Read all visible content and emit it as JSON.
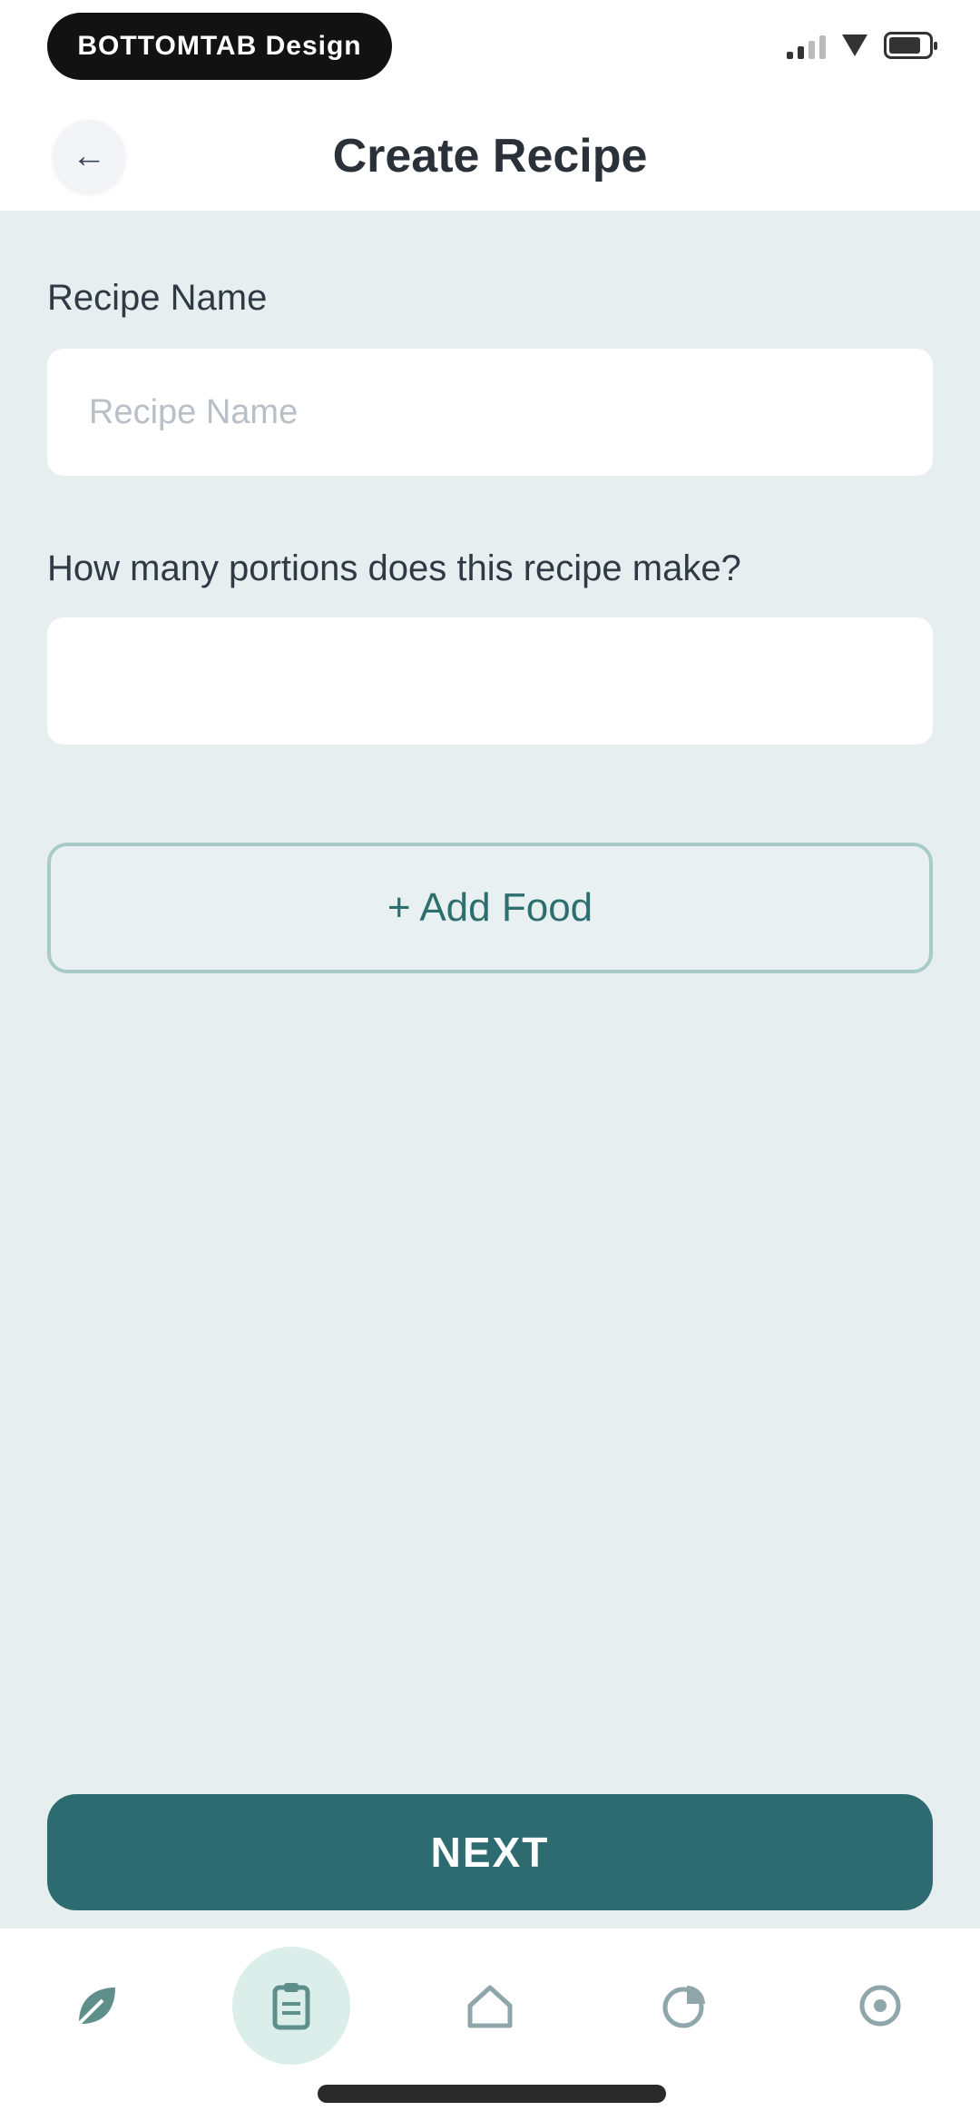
{
  "status_bar": {
    "pill_text": "BOTTOMTAB Design"
  },
  "header": {
    "title": "Create Recipe",
    "back_icon": "arrow-left-icon"
  },
  "form": {
    "recipe_name": {
      "label": "Recipe Name",
      "placeholder": "Recipe Name",
      "value": ""
    },
    "portions": {
      "label": "How many portions does this recipe make?",
      "placeholder": "",
      "value": ""
    },
    "add_food_label": "+ Add Food"
  },
  "actions": {
    "next_label": "NEXT"
  },
  "bottom_nav": {
    "items": [
      {
        "icon": "leaf-icon",
        "active": false
      },
      {
        "icon": "clipboard-icon",
        "active": true
      },
      {
        "icon": "home-icon",
        "active": false
      },
      {
        "icon": "pie-chart-icon",
        "active": false
      },
      {
        "icon": "settings-icon",
        "active": false
      }
    ]
  },
  "colors": {
    "accent": "#2e6b70",
    "background": "#e6eef0",
    "active_nav_bg": "#dbeee9"
  }
}
